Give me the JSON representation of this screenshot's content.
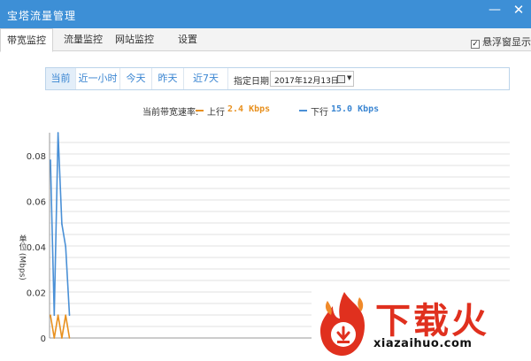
{
  "window": {
    "title": "宝塔流量管理",
    "minimize_glyph": "—",
    "close_glyph": "✕"
  },
  "tabs": [
    {
      "label": "带宽监控",
      "active": true
    },
    {
      "label": "流量监控",
      "active": false
    },
    {
      "label": "网站监控",
      "active": false
    },
    {
      "label": "设置",
      "active": false
    }
  ],
  "float_window": {
    "label": "悬浮窗显示",
    "checked": true
  },
  "filters": {
    "buttons": [
      {
        "label": "当前",
        "active": true
      },
      {
        "label": "近一小时",
        "active": false
      },
      {
        "label": "今天",
        "active": false
      },
      {
        "label": "昨天",
        "active": false
      },
      {
        "label": "近7天",
        "active": false
      }
    ],
    "date_label": "指定日期",
    "date_value": "2017年12月13日"
  },
  "rates": {
    "label": "当前带宽速率:",
    "upload_label": "上行",
    "upload_value": "2.4 Kbps",
    "download_label": "下行",
    "download_value": "15.0 Kbps"
  },
  "colors": {
    "titlebar": "#3d8fd6",
    "upload": "#e8901e",
    "download": "#4a90d6",
    "brand": "#e0301e"
  },
  "chart_data": {
    "type": "line",
    "ylabel": "单位 (Mbps)",
    "ylim": [
      0,
      0.09
    ],
    "y_ticks": [
      0,
      0.02,
      0.04,
      0.06,
      0.08
    ],
    "y_tick_labels": [
      "0",
      "0.02",
      "0.04",
      "0.06",
      "0.08"
    ],
    "grid": true,
    "x": [
      0,
      1,
      2,
      3,
      4,
      5
    ],
    "series": [
      {
        "name": "下行",
        "values": [
          0.078,
          0.01,
          0.09,
          0.05,
          0.04,
          0.01
        ]
      },
      {
        "name": "上行",
        "values": [
          0.01,
          0.0,
          0.01,
          0.0,
          0.01,
          0.0
        ]
      }
    ]
  },
  "watermark": {
    "brand": "下载火",
    "url": "xiazaihuo.com"
  }
}
